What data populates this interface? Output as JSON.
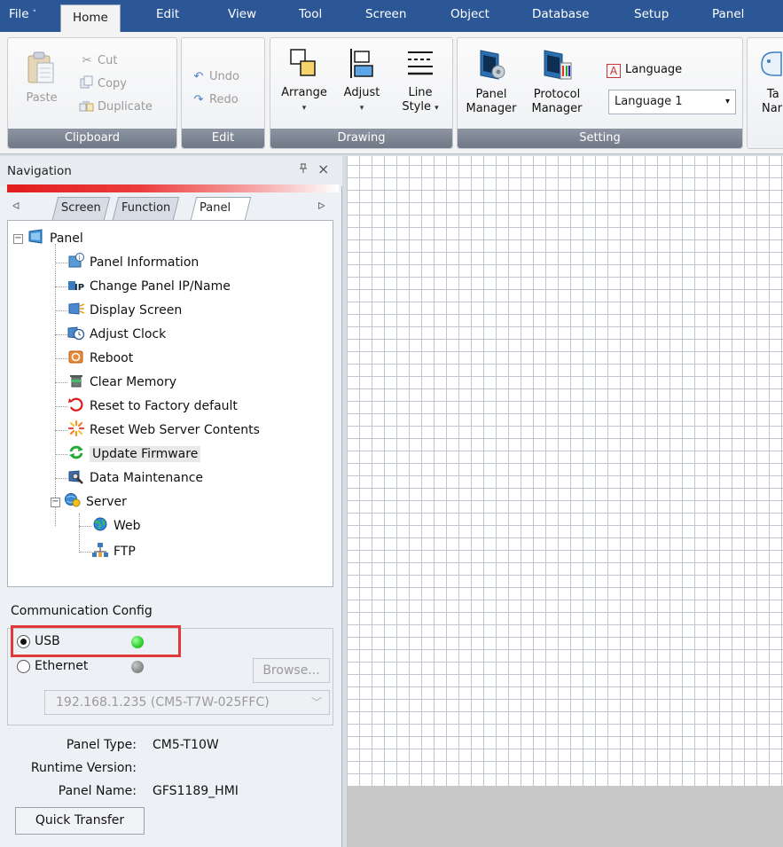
{
  "menubar": {
    "items": [
      {
        "label": "File"
      },
      {
        "label": "Home"
      },
      {
        "label": "Edit"
      },
      {
        "label": "View"
      },
      {
        "label": "Tool"
      },
      {
        "label": "Screen"
      },
      {
        "label": "Object"
      },
      {
        "label": "Database"
      },
      {
        "label": "Setup"
      },
      {
        "label": "Panel"
      }
    ],
    "active": "Home",
    "file_arrow": "˅"
  },
  "ribbon": {
    "clipboard": {
      "group_label": "Clipboard",
      "paste": "Paste",
      "cut": "Cut",
      "copy": "Copy",
      "duplicate": "Duplicate"
    },
    "edit": {
      "group_label": "Edit",
      "undo": "Undo",
      "redo": "Redo"
    },
    "drawing": {
      "group_label": "Drawing",
      "arrange": "Arrange",
      "adjust": "Adjust",
      "line_style_1": "Line",
      "line_style_2": "Style",
      "caret": "▾"
    },
    "setting": {
      "group_label": "Setting",
      "panel_manager_1": "Panel",
      "panel_manager_2": "Manager",
      "protocol_manager_1": "Protocol",
      "protocol_manager_2": "Manager",
      "language_label": "Language",
      "language_value": "Language 1"
    },
    "partial": {
      "line1": "Ta",
      "line2": "Nar"
    }
  },
  "navigation": {
    "title": "Navigation",
    "pin": "ᵖ",
    "close": "×",
    "tabs": [
      "Screen",
      "Function",
      "Panel"
    ],
    "active_tab": "Panel",
    "tree": {
      "root": "Panel",
      "items": [
        "Panel Information",
        "Change Panel IP/Name",
        "Display Screen",
        "Adjust Clock",
        "Reboot",
        "Clear Memory",
        "Reset to Factory default",
        "Reset Web Server Contents",
        "Update Firmware",
        "Data Maintenance"
      ],
      "server": "Server",
      "server_children": [
        "Web",
        "FTP"
      ],
      "selected": "Update Firmware"
    },
    "comm": {
      "label": "Communication Config",
      "usb": "USB",
      "ethernet": "Ethernet",
      "selected": "USB",
      "usb_status_color": "#2fcf2f",
      "ethernet_status_color": "#8a8a8a",
      "browse": "Browse...",
      "ip_value": "192.168.1.235 (CM5-T7W-025FFC)"
    },
    "info": {
      "panel_type_label": "Panel Type:",
      "panel_type_value": "CM5-T10W",
      "runtime_label": "Runtime Version:",
      "runtime_value": "",
      "panel_name_label": "Panel Name:",
      "panel_name_value": "GFS1189_HMI"
    },
    "quick_transfer": "Quick Transfer"
  },
  "colors": {
    "menubar_bg": "#2b5797",
    "highlight_red": "#e03a3a",
    "grid_line": "#bfc6cf"
  }
}
